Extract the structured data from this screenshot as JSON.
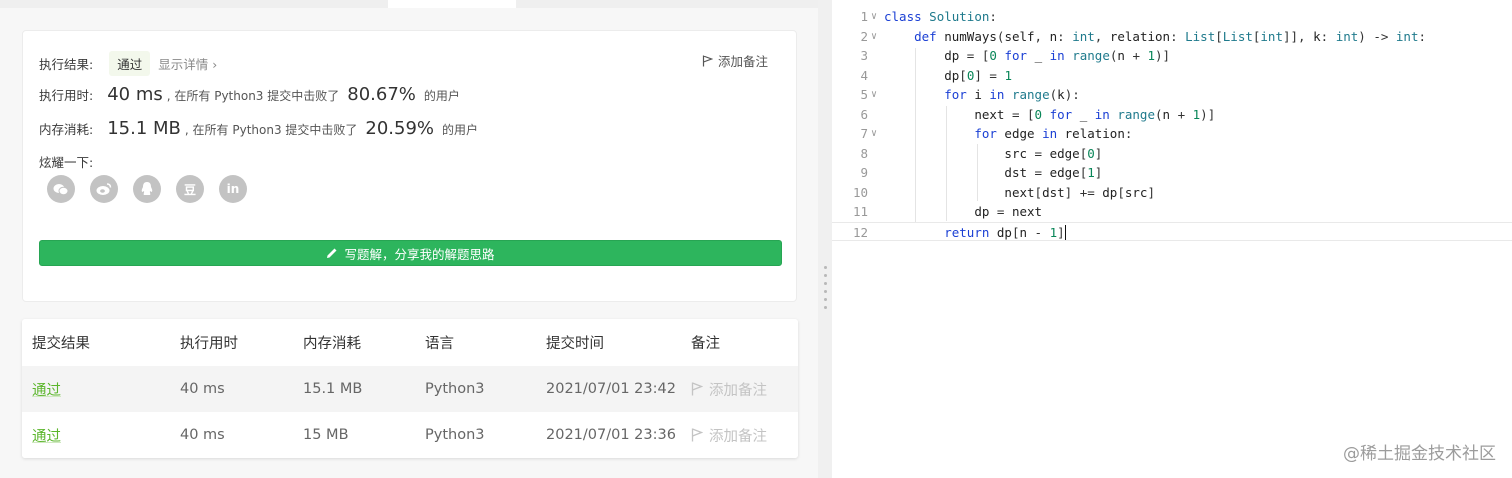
{
  "result": {
    "status_label": "执行结果:",
    "status_value": "通过",
    "detail_link": "显示详情 ›",
    "add_note": "添加备注",
    "runtime_label": "执行用时:",
    "runtime_value": "40 ms",
    "runtime_text": ", 在所有 Python3 提交中击败了",
    "runtime_pct": "80.67%",
    "runtime_suffix": "的用户",
    "memory_label": "内存消耗:",
    "memory_value": "15.1 MB",
    "memory_text": ", 在所有 Python3 提交中击败了",
    "memory_pct": "20.59%",
    "memory_suffix": "的用户",
    "share_label": "炫耀一下:",
    "share_icons": [
      "wechat-icon",
      "weibo-icon",
      "qq-icon",
      "douban-icon",
      "linkedin-icon"
    ],
    "share_glyphs": {
      "douban": "豆",
      "linkedin": "in"
    },
    "solution_button": "写题解，分享我的解题思路"
  },
  "submissions": {
    "headers": [
      "提交结果",
      "执行用时",
      "内存消耗",
      "语言",
      "提交时间",
      "备注"
    ],
    "rows": [
      {
        "status": "通过",
        "runtime": "40 ms",
        "memory": "15.1 MB",
        "language": "Python3",
        "time": "2021/07/01 23:42",
        "note": "添加备注"
      },
      {
        "status": "通过",
        "runtime": "40 ms",
        "memory": "15 MB",
        "language": "Python3",
        "time": "2021/07/01 23:36",
        "note": "添加备注"
      }
    ]
  },
  "editor": {
    "line_numbers": [
      "1",
      "2",
      "3",
      "4",
      "5",
      "6",
      "7",
      "8",
      "9",
      "10",
      "11",
      "12"
    ],
    "lines": [
      "class Solution:",
      "    def numWays(self, n: int, relation: List[List[int]], k: int) -> int:",
      "        dp = [0 for _ in range(n + 1)]",
      "        dp[0] = 1",
      "        for i in range(k):",
      "            next = [0 for _ in range(n + 1)]",
      "            for edge in relation:",
      "                src = edge[0]",
      "                dst = edge[1]",
      "                next[dst] += dp[src]",
      "            dp = next",
      "        return dp[n - 1]"
    ]
  },
  "watermark": "@稀土掘金技术社区",
  "colors": {
    "accent_green": "#2db55d",
    "pass_green": "#5cb62c",
    "keyword_blue": "#1a3fd4"
  }
}
